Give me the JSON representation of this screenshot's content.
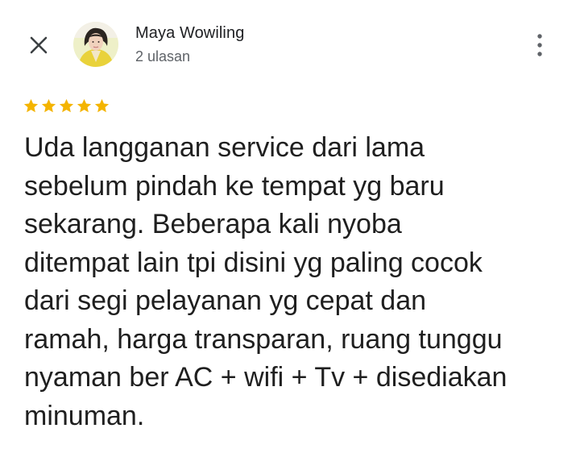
{
  "header": {
    "close_icon": "close-icon",
    "reviewer_name": "Maya Wowiling",
    "review_count": "2 ulasan",
    "more_icon": "more-vert-icon"
  },
  "review": {
    "rating": 5,
    "star_color": "#f4b400",
    "text": "Uda langganan service dari lama\nsebelum pindah ke tempat yg baru\nsekarang. Beberapa kali nyoba\nditempat lain tpi disini yg paling cocok\ndari segi pelayanan yg cepat dan\nramah, harga transparan, ruang tunggu\nnyaman ber AC + wifi + Tv + disediakan\nminuman."
  }
}
